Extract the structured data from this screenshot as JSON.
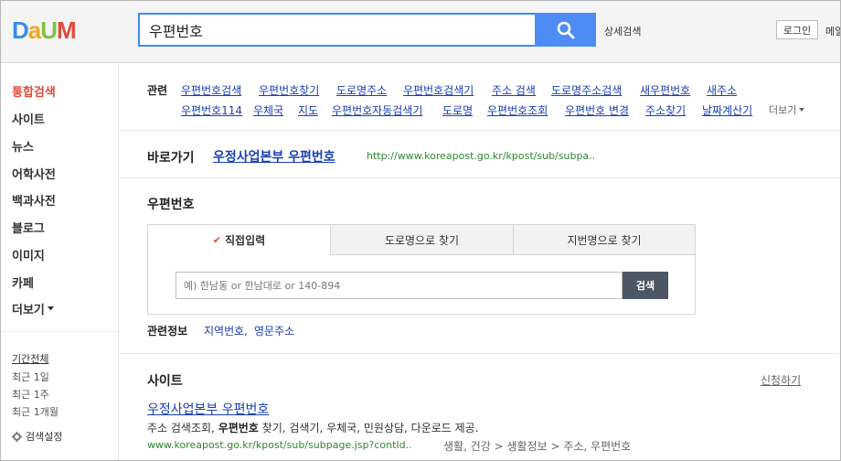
{
  "header": {
    "logo": [
      "D",
      "a",
      "U",
      "M"
    ],
    "logo_colors": [
      "#3b8de9",
      "#f5a623",
      "#7dc243",
      "#e24a3b"
    ],
    "search_value": "우편번호",
    "advanced_search": "상세검색",
    "login": "로그인",
    "mail": "메일"
  },
  "sidebar": {
    "items": [
      {
        "label": "통합검색",
        "active": true
      },
      {
        "label": "사이트"
      },
      {
        "label": "뉴스"
      },
      {
        "label": "어학사전"
      },
      {
        "label": "백과사전"
      },
      {
        "label": "블로그"
      },
      {
        "label": "이미지"
      },
      {
        "label": "카페"
      },
      {
        "label": "더보기"
      }
    ],
    "period_title": "기간전체",
    "period_items": [
      "최근 1일",
      "최근 1주",
      "최근 1개월"
    ],
    "search_setting": "검색설정"
  },
  "related": {
    "label": "관련",
    "row1": [
      "우편번호검색",
      "우편번호찾기",
      "도로명주소",
      "우편번호검색기",
      "주소 검색",
      "도로명주소검색",
      "새우편번호",
      "새주소"
    ],
    "row2": [
      "우편번호114",
      "우체국",
      "지도",
      "우편번호자동검색기",
      "도로명",
      "우편번호조회",
      "우편번호 변경",
      "주소찾기",
      "날짜계산기"
    ],
    "more": "더보기"
  },
  "shortcut": {
    "label": "바로가기",
    "link": "우정사업본부 우편번호",
    "url": "http://www.koreapost.go.kr/kpost/sub/subpa.."
  },
  "zipcode": {
    "title": "우편번호",
    "tabs": [
      "직접입력",
      "도로명으로 찾기",
      "지번명으로 찾기"
    ],
    "placeholder": "예) 한남동 or 한남대로 or 140-894",
    "search_button": "검색",
    "info_label": "관련정보",
    "info_links": [
      "지역번호,",
      "영문주소"
    ]
  },
  "site": {
    "title": "사이트",
    "apply": "신청하기",
    "result": {
      "title": "우정사업본부 우편번호",
      "desc_pre": "주소 검색조회, ",
      "desc_bold": "우편번호",
      "desc_post": " 찾기, 검색기, 우체국, 민원상담, 다운로드 제공.",
      "url": "www.koreapost.go.kr/kpost/sub/subpage.jsp?contId..",
      "path": "생활, 건강 > 생활정보 > 주소, 우편번호"
    }
  },
  "colors": {
    "accent": "#3f88f7",
    "active_red": "#e24a3b",
    "link_blue": "#1a3fb3",
    "url_green": "#2d8a2d"
  }
}
